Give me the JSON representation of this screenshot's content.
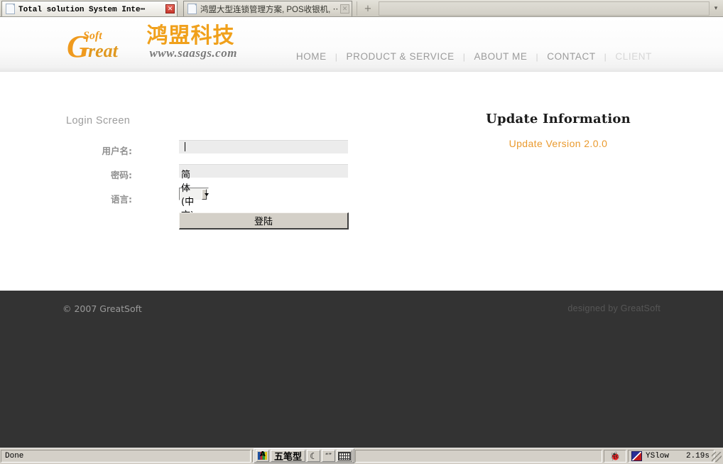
{
  "browser": {
    "tabs": [
      {
        "title": "Total solution System Inte⋯",
        "close_label": "✕",
        "active": true
      },
      {
        "title": "鸿盟大型连锁管理方案, POS收银机, ⋯",
        "close_label": "✕",
        "active": false
      }
    ],
    "new_tab_label": "+",
    "tab_list_arrow": "▾"
  },
  "header": {
    "logo": {
      "soft": "Soft",
      "g": "G",
      "reat": "reat",
      "cn_name": "鸿盟科技",
      "url": "www.saasgs.com"
    },
    "nav": [
      {
        "label": "HOME",
        "disabled": false
      },
      {
        "label": "PRODUCT & SERVICE",
        "disabled": false
      },
      {
        "label": "ABOUT ME",
        "disabled": false
      },
      {
        "label": "CONTACT",
        "disabled": false
      },
      {
        "label": "CLIENT",
        "disabled": true
      }
    ],
    "nav_separator": "|"
  },
  "login": {
    "screen_title": "Login Screen",
    "username": {
      "label": "用户名:",
      "value": "",
      "placeholder": ""
    },
    "password": {
      "label": "密码:",
      "value": "",
      "placeholder": ""
    },
    "language": {
      "label": "语言:",
      "selected": "简体(中文)",
      "options": [
        "简体(中文)"
      ]
    },
    "submit_label": "登陆"
  },
  "update": {
    "title": "Update Information",
    "version_text": "Update Version 2.0.0",
    "accent_color": "#ea9a2e"
  },
  "footer": {
    "copyright": "© 2007 GreatSoft",
    "designed_by": "designed by GreatSoft"
  },
  "statusbar": {
    "status_text": "Done",
    "ime": {
      "input_method": "五笔型",
      "mode_glyph": "☾",
      "punctuation_glyph": "“”",
      "icon_name": "ime-language-icon",
      "keyboard_name": "soft-keyboard-icon"
    },
    "firebug_icon": "🐞",
    "yslow": {
      "label": "YSlow",
      "time": "2.19s"
    }
  }
}
